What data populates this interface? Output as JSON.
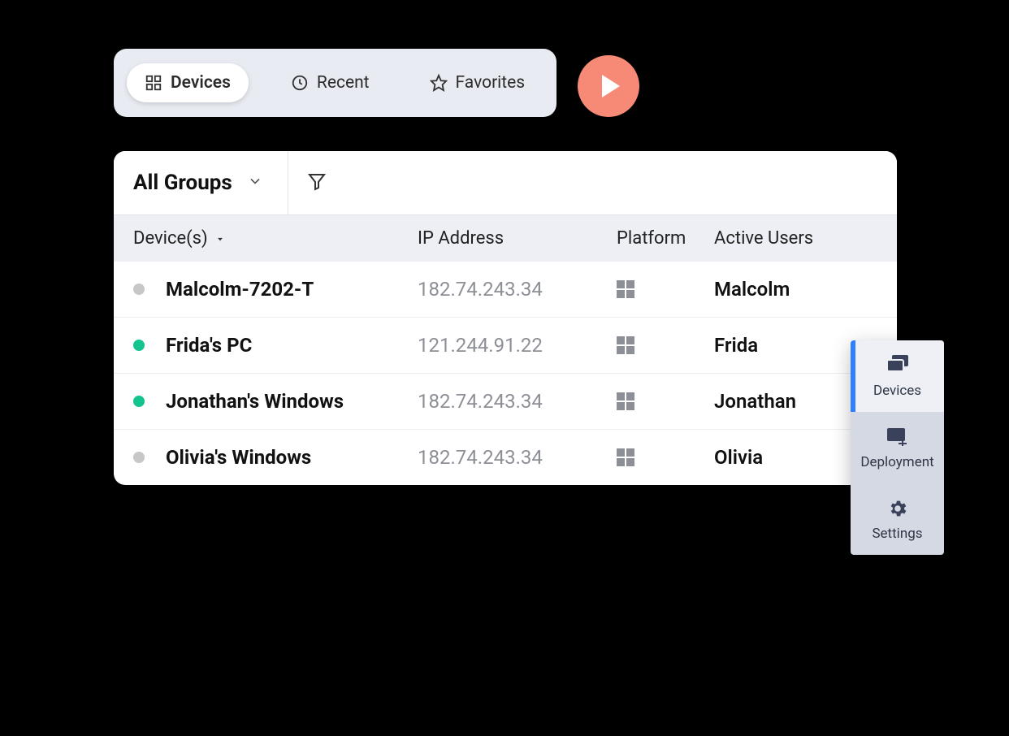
{
  "tabs": {
    "devices": {
      "label": "Devices",
      "active": true
    },
    "recent": {
      "label": "Recent",
      "active": false
    },
    "favorites": {
      "label": "Favorites",
      "active": false
    }
  },
  "toolbar": {
    "group_label": "All Groups"
  },
  "headers": {
    "device": "Device(s)",
    "ip": "IP Address",
    "platform": "Platform",
    "user": "Active Users"
  },
  "rows": [
    {
      "status": "offline",
      "name": "Malcolm-7202-T",
      "ip": "182.74.243.34",
      "platform": "windows",
      "user": "Malcolm"
    },
    {
      "status": "online",
      "name": "Frida's PC",
      "ip": "121.244.91.22",
      "platform": "windows",
      "user": "Frida"
    },
    {
      "status": "online",
      "name": "Jonathan's Windows",
      "ip": "182.74.243.34",
      "platform": "windows",
      "user": "Jonathan"
    },
    {
      "status": "offline",
      "name": "Olivia's Windows",
      "ip": "182.74.243.34",
      "platform": "windows",
      "user": "Olivia"
    }
  ],
  "rail": {
    "devices": {
      "label": "Devices",
      "active": true
    },
    "deployment": {
      "label": "Deployment",
      "active": false
    },
    "settings": {
      "label": "Settings",
      "active": false
    }
  }
}
